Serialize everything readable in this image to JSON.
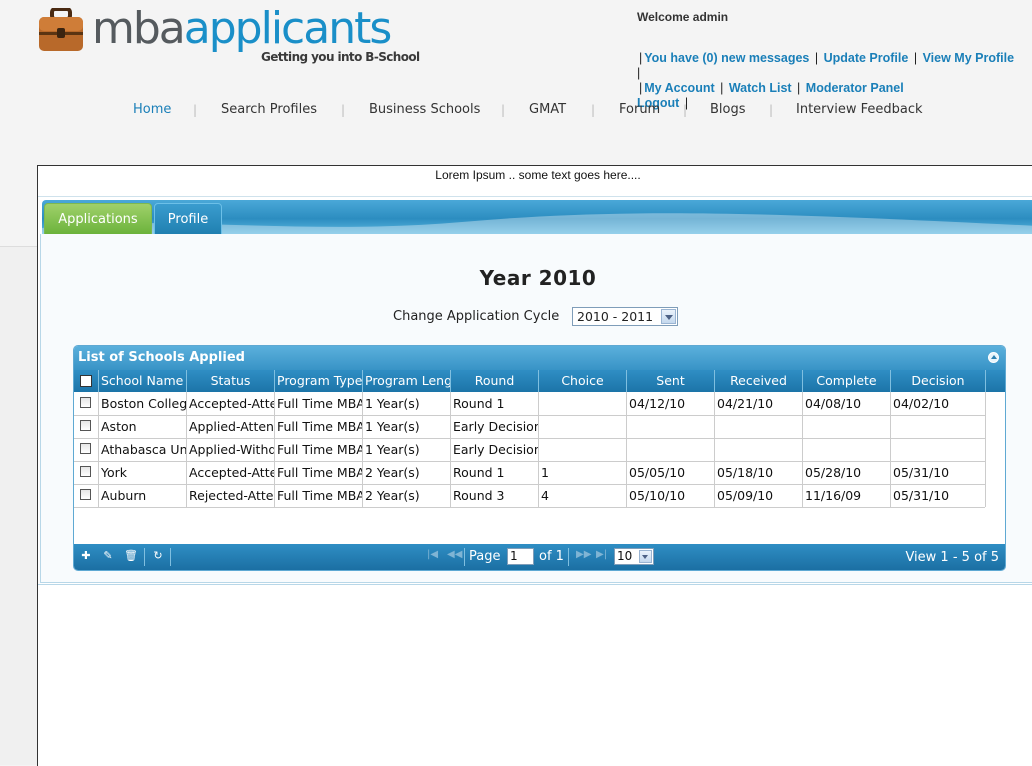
{
  "header": {
    "logo": {
      "part1": "mba",
      "part2": "applicants",
      "tagline": "Getting you into B-School"
    },
    "welcome": "Welcome admin",
    "user_links": {
      "messages": "You have (0) new messages",
      "update_profile": "Update Profile",
      "view_profile": "View My Profile",
      "my_account": "My Account",
      "watch_list": "Watch List",
      "moderator_panel": "Moderator Panel",
      "logout": "Logout"
    },
    "nav": [
      "Home",
      "Search Profiles",
      "Business Schools",
      "GMAT",
      "Forum",
      "Blogs",
      "Interview Feedback"
    ],
    "active_nav": "Home"
  },
  "content": {
    "lorem": "Lorem Ipsum .. some text goes here....",
    "tabs": [
      "Applications",
      "Profile"
    ],
    "active_tab": "Applications",
    "year_title": "Year 2010",
    "cycle_label": "Change Application Cycle",
    "cycle_value": "2010 - 2011"
  },
  "grid": {
    "title": "List of Schools Applied",
    "columns": [
      "School Name",
      "Status",
      "Program Type",
      "Program Length",
      "Round",
      "Choice",
      "Sent",
      "Received",
      "Complete",
      "Decision"
    ],
    "rows": [
      [
        "Boston College",
        "Accepted-Attending",
        "Full Time MBA",
        "1 Year(s)",
        "Round 1",
        "",
        "04/12/10",
        "04/21/10",
        "04/08/10",
        "04/02/10"
      ],
      [
        "Aston",
        "Applied-Attending",
        "Full Time MBA",
        "1 Year(s)",
        "Early Decision",
        "",
        "",
        "",
        "",
        ""
      ],
      [
        "Athabasca University",
        "Applied-Withdrawn",
        "Full Time MBA",
        "1 Year(s)",
        "Early Decision",
        "",
        "",
        "",
        "",
        ""
      ],
      [
        "York",
        "Accepted-Attending",
        "Full Time MBA",
        "2 Year(s)",
        "Round 1",
        "1",
        "05/05/10",
        "05/18/10",
        "05/28/10",
        "05/31/10"
      ],
      [
        "Auburn",
        "Rejected-Attending",
        "Full Time MBA",
        "2 Year(s)",
        "Round 3",
        "4",
        "05/10/10",
        "05/09/10",
        "11/16/09",
        "05/31/10"
      ]
    ],
    "pager": {
      "page_label": "Page",
      "page_value": "1",
      "of_label": "of 1",
      "rows_per_page": "10",
      "view_text": "View 1 - 5 of 5"
    },
    "icons": [
      "add-icon",
      "edit-icon",
      "delete-icon",
      "refresh-icon"
    ]
  },
  "colors": {
    "brand_blue": "#1a8fc8",
    "tab_green": "#6ab23a",
    "grid_header": "#2f8ec4"
  }
}
